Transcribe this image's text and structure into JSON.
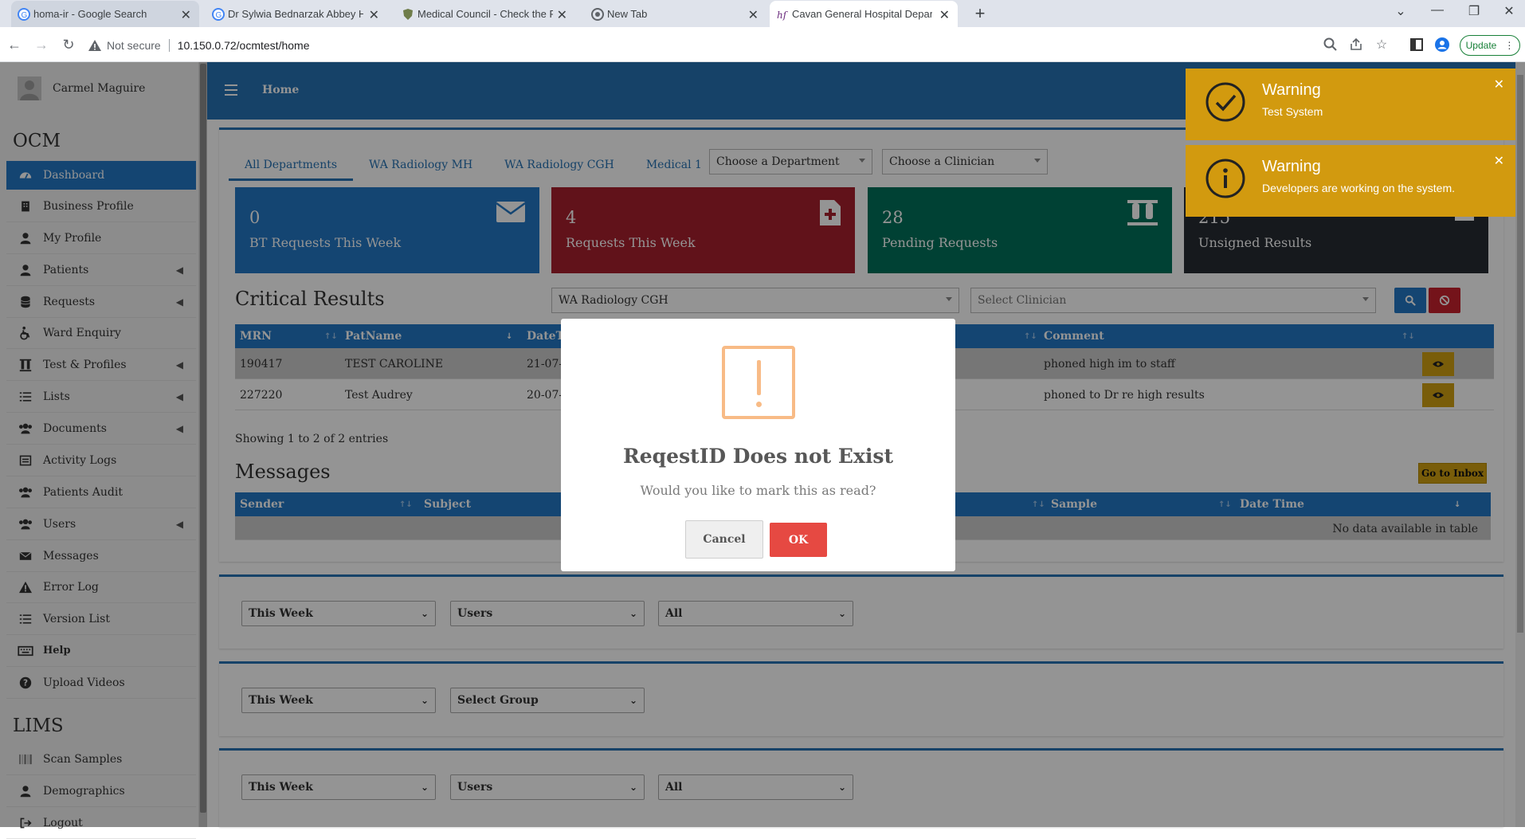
{
  "browser": {
    "tabs": [
      {
        "title": "homa-ir - Google Search"
      },
      {
        "title": "Dr Sylwia Bednarzak Abbey Hou"
      },
      {
        "title": "Medical Council - Check the Re"
      },
      {
        "title": "New Tab"
      },
      {
        "title": "Cavan General Hospital Departr"
      }
    ],
    "not_secure": "Not secure",
    "url": "10.150.0.72/ocmtest/home",
    "update_label": "Update"
  },
  "sidebar": {
    "user_name": "Carmel Maguire",
    "ocm_heading": "OCM",
    "items": [
      {
        "label": "Dashboard",
        "icon": "dashboard-icon"
      },
      {
        "label": "Business Profile",
        "icon": "building-icon"
      },
      {
        "label": "My Profile",
        "icon": "user-icon"
      },
      {
        "label": "Patients",
        "icon": "user-icon"
      },
      {
        "label": "Requests",
        "icon": "database-icon"
      },
      {
        "label": "Ward Enquiry",
        "icon": "wheelchair-icon"
      },
      {
        "label": "Test & Profiles",
        "icon": "vials-icon"
      },
      {
        "label": "Lists",
        "icon": "list-icon"
      },
      {
        "label": "Documents",
        "icon": "users-icon"
      },
      {
        "label": "Activity Logs",
        "icon": "log-icon"
      },
      {
        "label": "Patients Audit",
        "icon": "users-icon"
      },
      {
        "label": "Users",
        "icon": "users-icon"
      },
      {
        "label": "Messages",
        "icon": "envelope-icon"
      },
      {
        "label": "Error Log",
        "icon": "warning-icon"
      },
      {
        "label": "Version List",
        "icon": "list-icon"
      },
      {
        "label": "Help",
        "icon": "keyboard-icon"
      },
      {
        "label": "Upload Videos",
        "icon": "question-icon"
      }
    ],
    "lims_heading": "LIMS",
    "lims_items": [
      {
        "label": "Scan Samples",
        "icon": "barcode-icon"
      },
      {
        "label": "Demographics",
        "icon": "user-icon"
      },
      {
        "label": "Logout",
        "icon": "logout-icon"
      }
    ]
  },
  "header": {
    "title": "Home"
  },
  "departments": {
    "tabs": [
      "All Departments",
      "WA Radiology MH",
      "WA Radiology CGH",
      "Medical 1"
    ],
    "dept_select": "Choose a Department",
    "clinician_select": "Choose a Clinician"
  },
  "stats": [
    {
      "value": "0",
      "label": "BT Requests This Week",
      "color": "#2478c4"
    },
    {
      "value": "4",
      "label": "Requests This Week",
      "color": "#a8202e"
    },
    {
      "value": "28",
      "label": "Pending Requests",
      "color": "#00705a"
    },
    {
      "value": "215",
      "label": "Unsigned Results",
      "color": "#262b33"
    }
  ],
  "critical": {
    "title": "Critical Results",
    "dept_filter": "WA Radiology CGH",
    "clinician_filter": "Select Clinician",
    "columns": [
      "MRN",
      "PatName",
      "DateTi",
      "Comment"
    ],
    "rows": [
      {
        "mrn": "190417",
        "name": "TEST CAROLINE",
        "date": "21-07-2",
        "comment": "phoned high im to staff"
      },
      {
        "mrn": "227220",
        "name": "Test Audrey",
        "date": "20-07-2",
        "comment": "phoned to Dr re high results"
      }
    ],
    "showing": "Showing 1 to 2 of 2 entries"
  },
  "messages": {
    "title": "Messages",
    "inbox_button": "Go to Inbox",
    "columns": [
      "Sender",
      "Subject",
      "Sample",
      "Date Time"
    ],
    "empty": "No data available in table"
  },
  "filters": {
    "row1": [
      "This Week",
      "Users",
      "All"
    ],
    "row2": [
      "This Week",
      "Select Group"
    ],
    "row3": [
      "This Week",
      "Users",
      "All"
    ]
  },
  "toasts": [
    {
      "title": "Warning",
      "message": "Test System"
    },
    {
      "title": "Warning",
      "message": "Developers are working on the system."
    }
  ],
  "modal": {
    "title": "ReqestID Does not Exist",
    "question": "Would you like to mark this as read?",
    "cancel": "Cancel",
    "ok": "OK"
  }
}
